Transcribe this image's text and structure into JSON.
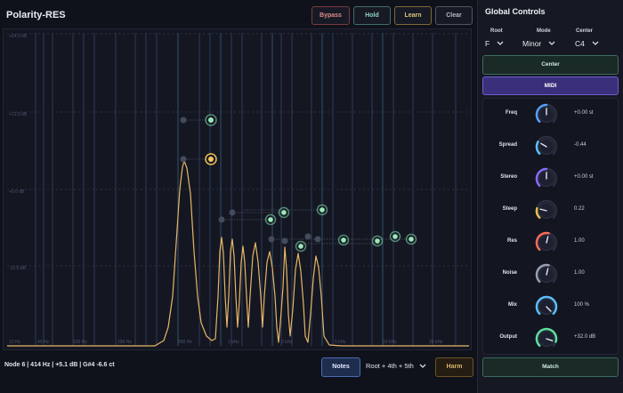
{
  "app": {
    "title": "Polarity-RES"
  },
  "toolbar": {
    "bypass": "Bypass",
    "hold": "Hold",
    "learn": "Learn",
    "clear": "Clear"
  },
  "graph": {
    "y_labels": [
      "+24.0 dB",
      "+12.0 dB",
      "+0.0 dB",
      "-12.0 dB"
    ],
    "x_labels": [
      "10 Hz",
      "40 Hz",
      "100 Hz",
      "200 Hz",
      "500 Hz",
      "1 kHz",
      "2 kHz",
      "5 kHz",
      "10 kHz",
      "20 kHz"
    ]
  },
  "status": {
    "text": "Node 6  |  414 Hz  |  +5.1 dB  |  G#4 -6.6 ct"
  },
  "bottom": {
    "notes": "Notes",
    "chord": "Root + 4th + 5th",
    "harm": "Harm"
  },
  "panel": {
    "title": "Global Controls",
    "root_label": "Root",
    "root_value": "F",
    "mode_label": "Mode",
    "mode_value": "Minor",
    "center_label": "Center",
    "center_value": "C4",
    "center_button": "Center",
    "midi_button": "MIDI",
    "match_button": "Match",
    "knobs": [
      {
        "label": "Freq",
        "value": "+0.00 st",
        "level": 0.5,
        "color": "#5aa0ff"
      },
      {
        "label": "Spread",
        "value": "-0.44",
        "level": 0.28,
        "color": "#5fc0ff"
      },
      {
        "label": "Stereo",
        "value": "+0.00 st",
        "level": 0.5,
        "color": "#8a6bff"
      },
      {
        "label": "Steep",
        "value": "0.22",
        "level": 0.22,
        "color": "#e8c050"
      },
      {
        "label": "Res",
        "value": "1.00",
        "level": 0.55,
        "color": "#ff6b5a"
      },
      {
        "label": "Noise",
        "value": "1.00",
        "level": 0.55,
        "color": "#9aa0b0"
      },
      {
        "label": "Mix",
        "value": "100 %",
        "level": 1.0,
        "color": "#5ac0ff"
      },
      {
        "label": "Output",
        "value": "+32.0 dB",
        "level": 0.9,
        "color": "#5fe0a0"
      }
    ]
  }
}
